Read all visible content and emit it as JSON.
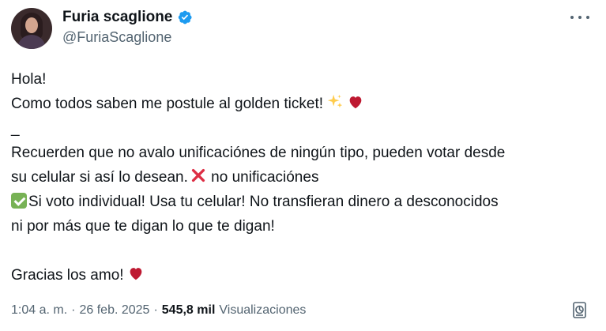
{
  "author": {
    "name": "Furia scaglione",
    "handle": "@FuriaScaglione",
    "verified": true
  },
  "tweet": {
    "lines": [
      "Hola!",
      "Como todos saben me postule al golden ticket!",
      "_",
      "Recuerden que no avalo unificaciónes de ningún tipo, pueden votar desde",
      "su celular si así lo desean.",
      " no unificaciónes",
      "Si voto individual! Usa tu celular! No transfieran dinero a desconocidos",
      "ni por más que te digan lo que te digan!",
      "Gracias los amo!"
    ],
    "emojis": {
      "sparkles": "sparkles-icon",
      "heart": "red-heart-icon",
      "cross": "cross-mark-icon",
      "check": "check-mark-button-icon"
    }
  },
  "meta": {
    "time": "1:04 a. m.",
    "separator": "·",
    "date": "26 feb. 2025",
    "separator2": "·",
    "views_count": "545,8 mil",
    "views_label": "Visualizaciones"
  },
  "colors": {
    "verified_blue": "#1d9bf0",
    "secondary_text": "#536471",
    "heart_red": "#be1931",
    "cross_red": "#dd2e44",
    "check_green": "#77b255"
  }
}
